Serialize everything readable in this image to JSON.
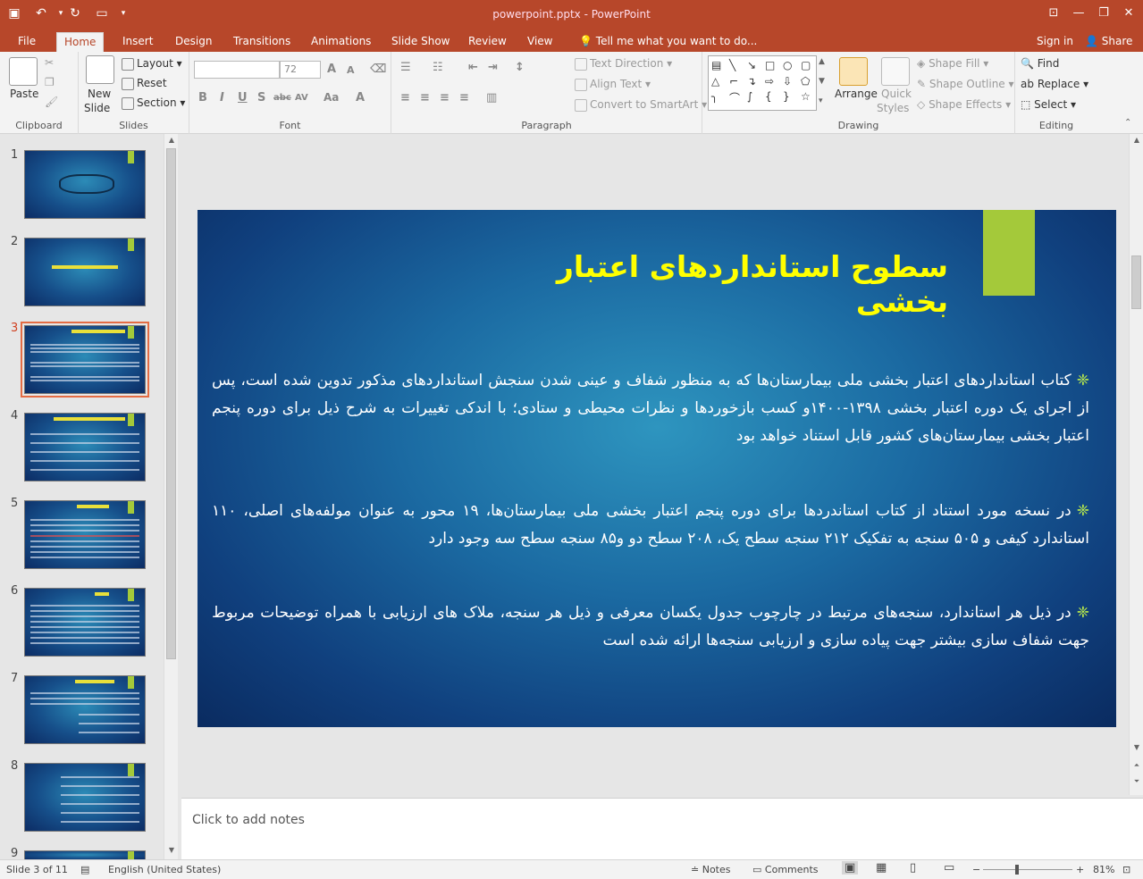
{
  "app": {
    "doc_title": "powerpoint.pptx - PowerPoint"
  },
  "tabs": [
    "File",
    "Home",
    "Insert",
    "Design",
    "Transitions",
    "Animations",
    "Slide Show",
    "Review",
    "View"
  ],
  "tell_me": "Tell me what you want to do...",
  "account": {
    "signin": "Sign in",
    "share": "Share"
  },
  "ribbon": {
    "clipboard": {
      "paste": "Paste",
      "label": "Clipboard"
    },
    "slides": {
      "new_slide": "New",
      "new_slide2": "Slide",
      "layout": "Layout",
      "reset": "Reset",
      "section": "Section",
      "label": "Slides"
    },
    "font": {
      "size": "72",
      "label": "Font",
      "bold": "B",
      "italic": "I",
      "underline": "U",
      "shadow": "S",
      "strike": "abc",
      "spacing": "AV",
      "case": "Aa",
      "grow": "A",
      "shrink": "A"
    },
    "paragraph": {
      "text_direction": "Text Direction",
      "align_text": "Align Text",
      "smartart": "Convert to SmartArt",
      "label": "Paragraph"
    },
    "drawing": {
      "arrange": "Arrange",
      "quick": "Quick",
      "styles": "Styles",
      "fill": "Shape Fill",
      "outline": "Shape Outline",
      "effects": "Shape Effects",
      "label": "Drawing"
    },
    "editing": {
      "find": "Find",
      "replace": "Replace",
      "select": "Select",
      "label": "Editing"
    }
  },
  "thumbnails": [
    {
      "num": "1"
    },
    {
      "num": "2"
    },
    {
      "num": "3"
    },
    {
      "num": "4"
    },
    {
      "num": "5"
    },
    {
      "num": "6"
    },
    {
      "num": "7"
    },
    {
      "num": "8"
    },
    {
      "num": "9"
    }
  ],
  "slide": {
    "title": "سطوح استانداردهای اعتبار بخشی",
    "bullet_symbol": "❈",
    "paragraphs": [
      "کتاب استانداردهای اعتبار بخشی ملی بیمارستان‌ها که به منظور شفاف و عینی شدن سنجش استانداردهای مذکور تدوین شده است، پس از اجرای یک دوره اعتبار بخشی ۱۳۹۸-۱۴۰۰و کسب بازخوردها و نظرات محیطی و ستادی؛ با اندکی تغییرات به شرح ذیل برای دوره پنجم اعتبار بخشی بیمارستان‌های کشور قابل استناد خواهد بود",
      "در نسخه مورد استناد از کتاب استاندردها برای دوره پنجم اعتبار بخشی ملی بیمارستان‌ها، ۱۹ محور به عنوان مولفه‌های اصلی، ۱۱۰ استاندارد کیفی و ۵۰۵ سنجه به تفکیک ۲۱۲ سنجه سطح یک، ۲۰۸ سطح دو و۸۵ سنجه سطح سه وجود دارد",
      "در ذیل هر استاندارد، سنجه‌های مرتبط در چارچوب جدول یکسان معرفی و ذیل هر سنجه، ملاک های ارزیابی با همراه توضیحات مربوط جهت شفاف سازی بیشتر جهت پیاده سازی و ارزیابی سنجه‌ها ارائه شده است"
    ]
  },
  "notes_placeholder": "Click to add notes",
  "status": {
    "slide_of": "Slide 3 of 11",
    "language": "English (United States)",
    "notes": "Notes",
    "comments": "Comments",
    "zoom": "81%"
  }
}
